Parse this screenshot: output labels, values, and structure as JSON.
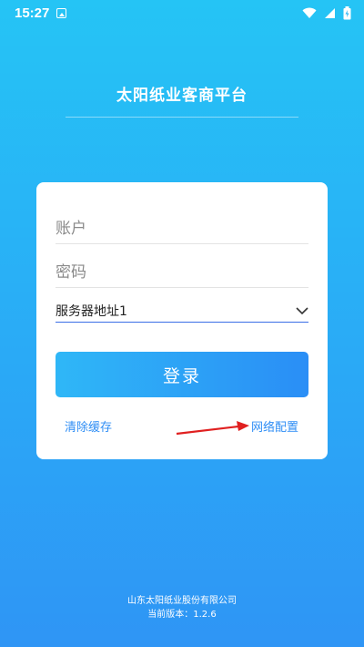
{
  "status_bar": {
    "time": "15:27"
  },
  "app": {
    "title": "太阳纸业客商平台"
  },
  "login": {
    "account_placeholder": "账户",
    "password_placeholder": "密码",
    "server_selected": "服务器地址1",
    "login_label": "登录",
    "clear_cache_label": "清除缓存",
    "network_config_label": "网络配置"
  },
  "footer": {
    "company": "山东太阳纸业股份有限公司",
    "version": "当前版本：1.2.6"
  },
  "colors": {
    "background_top": "#25c4f5",
    "background_bottom": "#2f95f5",
    "accent": "#2f8ef5",
    "annotation_arrow": "#e02020"
  }
}
